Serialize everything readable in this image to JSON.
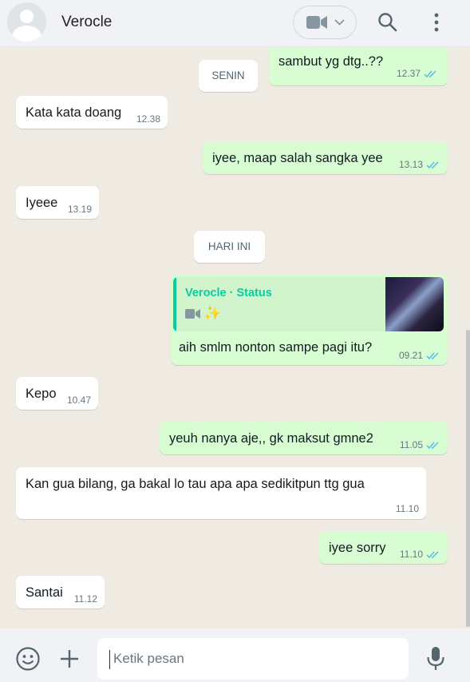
{
  "header": {
    "contact_name": "Verocle",
    "icons": [
      "avatar",
      "video-call-icon",
      "chevron-down-icon",
      "search-icon",
      "menu-icon"
    ]
  },
  "chat": {
    "day_separators": {
      "senin": "SENIN",
      "hari_ini": "HARI INI"
    },
    "messages": {
      "m1": {
        "text": "sambut yg dtg..??",
        "time": "12.37",
        "direction": "out",
        "status": "read"
      },
      "m2": {
        "text": "Kata kata doang",
        "time": "12.38",
        "direction": "in"
      },
      "m3": {
        "text": "iyee, maap salah sangka yee",
        "time": "13.13",
        "direction": "out",
        "status": "read"
      },
      "m4": {
        "text": "Iyeee",
        "time": "13.19",
        "direction": "in"
      },
      "m5": {
        "quote_name": "Verocle · Status",
        "quote_icons": [
          "video-icon",
          "sparkles-icon"
        ],
        "text": "aih smlm nonton sampe pagi itu?",
        "time": "09.21",
        "direction": "out",
        "status": "read"
      },
      "m6": {
        "text": "Kepo",
        "time": "10.47",
        "direction": "in"
      },
      "m7": {
        "text": "yeuh nanya aje,, gk  maksut gmne2",
        "time": "11.05",
        "direction": "out",
        "status": "read"
      },
      "m8": {
        "text": "Kan gua bilang, ga bakal lo tau apa apa sedikitpun ttg gua",
        "time": "11.10",
        "direction": "in"
      },
      "m9": {
        "text": "iyee sorry",
        "time": "11.10",
        "direction": "out",
        "status": "read"
      },
      "m10": {
        "text": "Santai",
        "time": "11.12",
        "direction": "in"
      }
    }
  },
  "footer": {
    "input_placeholder": "Ketik pesan",
    "icons": [
      "emoji-icon",
      "plus-icon",
      "mic-icon"
    ]
  },
  "colors": {
    "outgoing_bubble": "#d9fdd3",
    "incoming_bubble": "#ffffff",
    "read_ticks": "#53bdeb",
    "status_accent": "#06cf9c",
    "chat_background": "#efeae2"
  }
}
